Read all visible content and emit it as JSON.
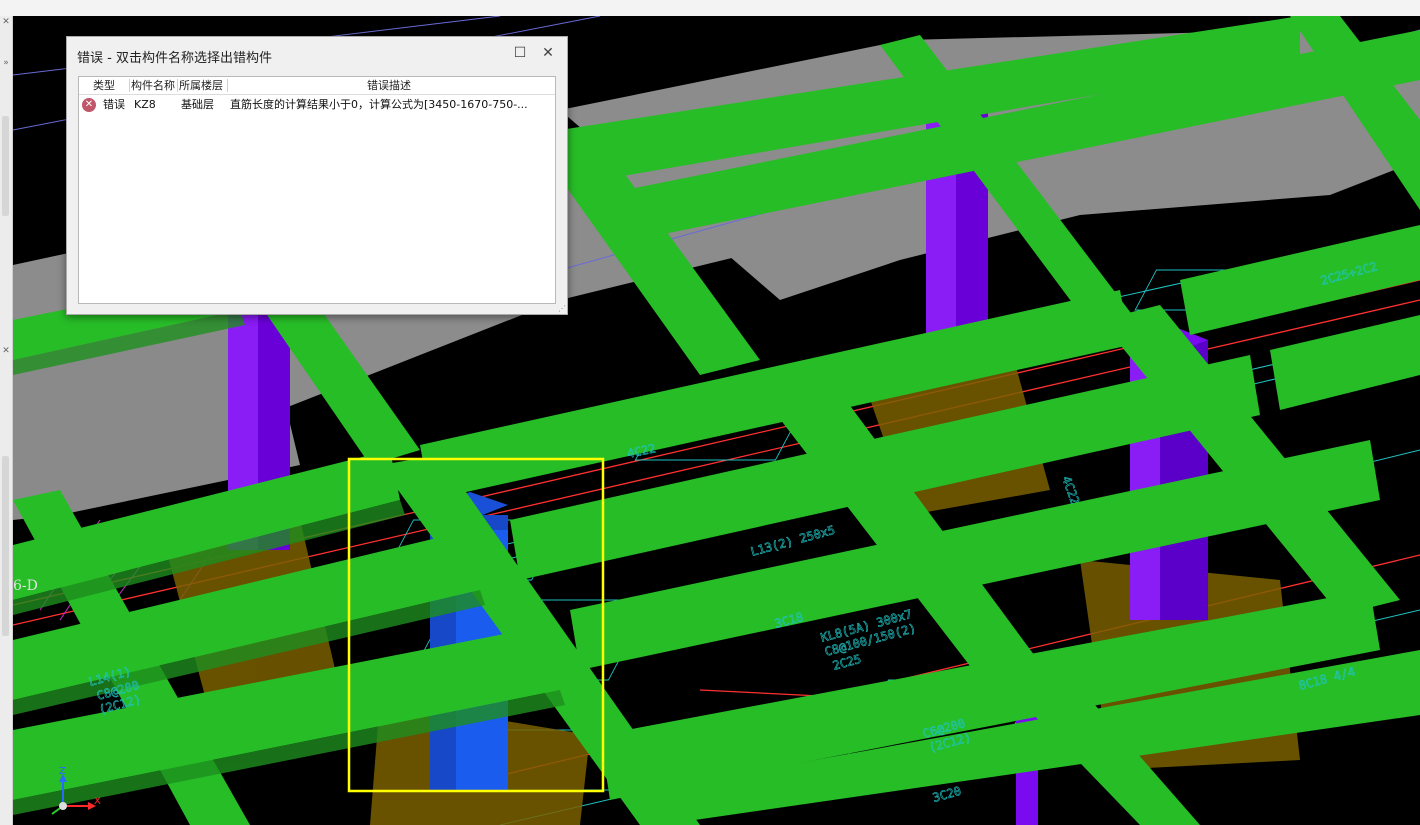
{
  "dialog": {
    "title": "错误 - 双击构件名称选择出错构件",
    "columns": [
      "类型",
      "构件名称",
      "所属楼层",
      "错误描述"
    ],
    "rows": [
      {
        "type": "错误",
        "name": "KZ8",
        "floor": "基础层",
        "description": "直筋长度的计算结果小于0，计算公式为[3450-1670-750-..."
      }
    ]
  },
  "viewport": {
    "annotations": [
      "4C22",
      "4C22",
      "L13(2) 250x5",
      "3C18",
      "KL8(5A) 300x7",
      "C8@100/150(2)",
      "2C25",
      "8C18 4/4",
      "2C25+2C2",
      "3C20",
      "C8@200",
      "(2C12)",
      "L14(1)",
      "C6@200",
      "(2C12)",
      "6-D"
    ],
    "axes": {
      "z": "Z",
      "x": "X"
    }
  },
  "colors": {
    "beam": "#27bd27",
    "column": "#7a0bf0",
    "selected_column": "#1a5cee",
    "slab": "#8c8c8c",
    "footing": "#7a6000",
    "highlight": "#ffff00",
    "error_icon": "#c0566a"
  }
}
